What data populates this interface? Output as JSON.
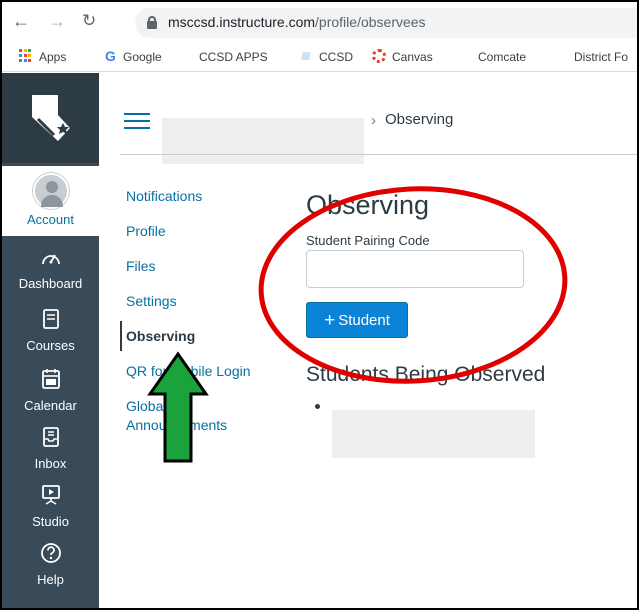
{
  "browser": {
    "url_host": "msccsd.instructure.com",
    "url_path": "/profile/observees",
    "bookmarks": [
      {
        "label": "Apps",
        "icon": "apps-grid-icon"
      },
      {
        "label": "Google",
        "icon": "google-icon"
      },
      {
        "label": "CCSD APPS",
        "icon": "globe-icon"
      },
      {
        "label": "CCSD",
        "icon": "ccsd-icon"
      },
      {
        "label": "Canvas",
        "icon": "canvas-icon"
      },
      {
        "label": "Comcate",
        "icon": "globe-icon"
      },
      {
        "label": "District Fo",
        "icon": "globe-icon"
      }
    ]
  },
  "global_nav": {
    "items": [
      {
        "label": "Account",
        "icon": "user-avatar-icon"
      },
      {
        "label": "Dashboard",
        "icon": "dashboard-gauge-icon"
      },
      {
        "label": "Courses",
        "icon": "book-icon"
      },
      {
        "label": "Calendar",
        "icon": "calendar-icon"
      },
      {
        "label": "Inbox",
        "icon": "inbox-icon"
      },
      {
        "label": "Studio",
        "icon": "studio-icon"
      },
      {
        "label": "Help",
        "icon": "help-icon"
      }
    ],
    "bg_color": "#394b58",
    "accent": "#0770a3"
  },
  "header": {
    "breadcrumb_current": "Observing"
  },
  "section_nav": {
    "items": [
      {
        "label": "Notifications"
      },
      {
        "label": "Profile"
      },
      {
        "label": "Files"
      },
      {
        "label": "Settings"
      },
      {
        "label": "Observing"
      },
      {
        "label": "QR for Mobile Login"
      },
      {
        "label": "Global"
      },
      {
        "label": "Announcements"
      }
    ],
    "active": "Observing"
  },
  "main": {
    "title": "Observing",
    "pairing_label": "Student Pairing Code",
    "pairing_value": "",
    "add_button_label": "Student",
    "observed_heading": "Students Being Observed",
    "observed_students": [
      ""
    ]
  },
  "annotations": {
    "circle_color": "#e00000",
    "arrow_color": "#1aa33a"
  }
}
